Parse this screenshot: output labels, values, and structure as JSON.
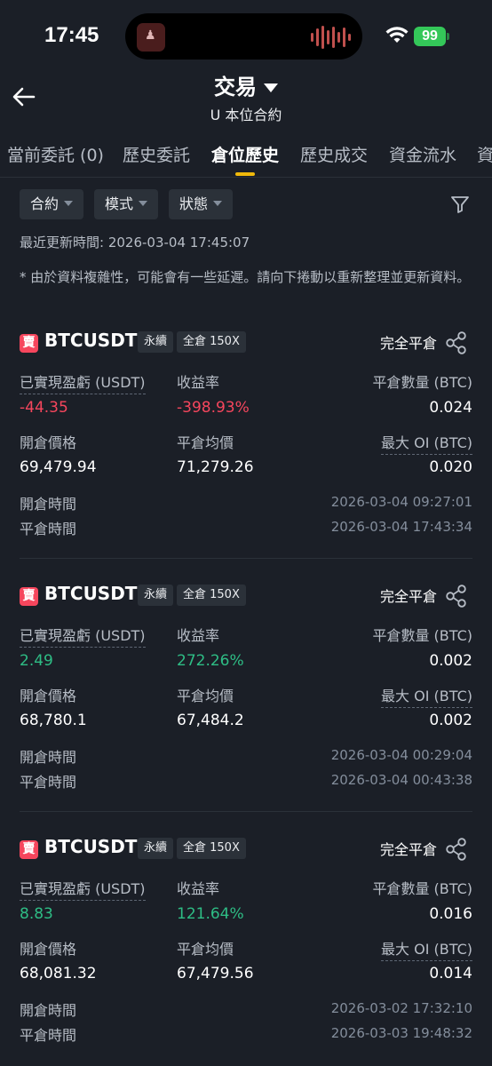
{
  "status_bar": {
    "time": "17:45",
    "battery": "99"
  },
  "header": {
    "title": "交易",
    "subtitle": "U 本位合約"
  },
  "tabs": [
    {
      "label": "當前委託 (0)",
      "active": false
    },
    {
      "label": "歷史委託",
      "active": false
    },
    {
      "label": "倉位歷史",
      "active": true
    },
    {
      "label": "歷史成交",
      "active": false
    },
    {
      "label": "資金流水",
      "active": false
    },
    {
      "label": "資",
      "active": false
    }
  ],
  "filters": {
    "contract": "合約",
    "mode": "模式",
    "status": "狀態"
  },
  "last_updated": "最近更新時間: 2026-03-04 17:45:07",
  "notice": "* 由於資料複雜性，可能會有一些延遲。請向下捲動以重新整理並更新資料。",
  "labels": {
    "realized_pnl": "已實現盈虧 (USDT)",
    "roi": "收益率",
    "closed_qty": "平倉數量 (BTC)",
    "entry_price": "開倉價格",
    "avg_close_price": "平倉均價",
    "max_oi": "最大 OI (BTC)",
    "open_time": "開倉時間",
    "close_time": "平倉時間"
  },
  "positions": [
    {
      "side": "賣",
      "symbol": "BTCUSDT",
      "type": "永續",
      "margin": "全倉 150X",
      "close_type": "完全平倉",
      "realized_pnl": "-44.35",
      "roi": "-398.93%",
      "closed_qty": "0.024",
      "entry_price": "69,479.94",
      "avg_close_price": "71,279.26",
      "max_oi": "0.020",
      "open_time": "2026-03-04 09:27:01",
      "close_time": "2026-03-04 17:43:34"
    },
    {
      "side": "賣",
      "symbol": "BTCUSDT",
      "type": "永續",
      "margin": "全倉 150X",
      "close_type": "完全平倉",
      "realized_pnl": "2.49",
      "roi": "272.26%",
      "closed_qty": "0.002",
      "entry_price": "68,780.1",
      "avg_close_price": "67,484.2",
      "max_oi": "0.002",
      "open_time": "2026-03-04 00:29:04",
      "close_time": "2026-03-04 00:43:38"
    },
    {
      "side": "賣",
      "symbol": "BTCUSDT",
      "type": "永續",
      "margin": "全倉 150X",
      "close_type": "完全平倉",
      "realized_pnl": "8.83",
      "roi": "121.64%",
      "closed_qty": "0.016",
      "entry_price": "68,081.32",
      "avg_close_price": "67,479.56",
      "max_oi": "0.014",
      "open_time": "2026-03-02 17:32:10",
      "close_time": "2026-03-03 19:48:32"
    }
  ],
  "colors": {
    "background": "#1b1f27",
    "negative": "#f6465d",
    "positive": "#2ebd85",
    "accent": "#f0b90b"
  }
}
